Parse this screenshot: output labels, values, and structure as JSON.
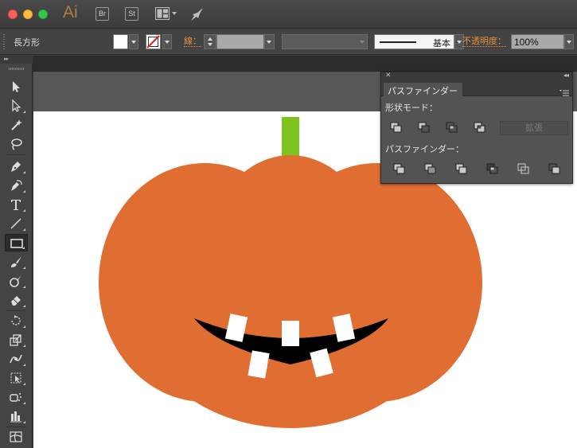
{
  "app": {
    "logo": "Ai",
    "bridge_button": "Br",
    "stock_button": "St"
  },
  "controlbar": {
    "tool_name": "長方形",
    "stroke_label": "線：",
    "brush_label": "基本",
    "opacity_label": "不透明度：",
    "opacity_value": "100%"
  },
  "pathfinder": {
    "tab_label": "パスファインダー",
    "shape_modes_label": "形状モード：",
    "pathfinders_label": "パスファインダー：",
    "expand_label": "拡張",
    "shape_mode_buttons": [
      "unite-icon",
      "minus-front-icon",
      "intersect-icon",
      "exclude-icon"
    ],
    "pathfinder_buttons": [
      "divide-icon",
      "trim-icon",
      "merge-icon",
      "crop-icon",
      "outline-icon",
      "minus-back-icon"
    ]
  },
  "tools": [
    "selection-tool-icon",
    "direct-selection-tool-icon",
    "magic-wand-tool-icon",
    "lasso-tool-icon",
    "pen-tool-icon",
    "curvature-tool-icon",
    "type-tool-icon",
    "line-segment-tool-icon",
    "rectangle-tool-icon",
    "paintbrush-tool-icon",
    "blob-brush-tool-icon",
    "eraser-tool-icon",
    "rotate-tool-icon",
    "scale-tool-icon",
    "width-tool-icon",
    "free-transform-tool-icon",
    "symbol-sprayer-tool-icon",
    "column-graph-tool-icon",
    "mesh-tool-icon"
  ],
  "colors": {
    "pumpkin": "#e06d32",
    "stem": "#7dc31d",
    "mouth": "#000000",
    "teeth": "#ffffff",
    "accent_label": "#e8913a"
  }
}
